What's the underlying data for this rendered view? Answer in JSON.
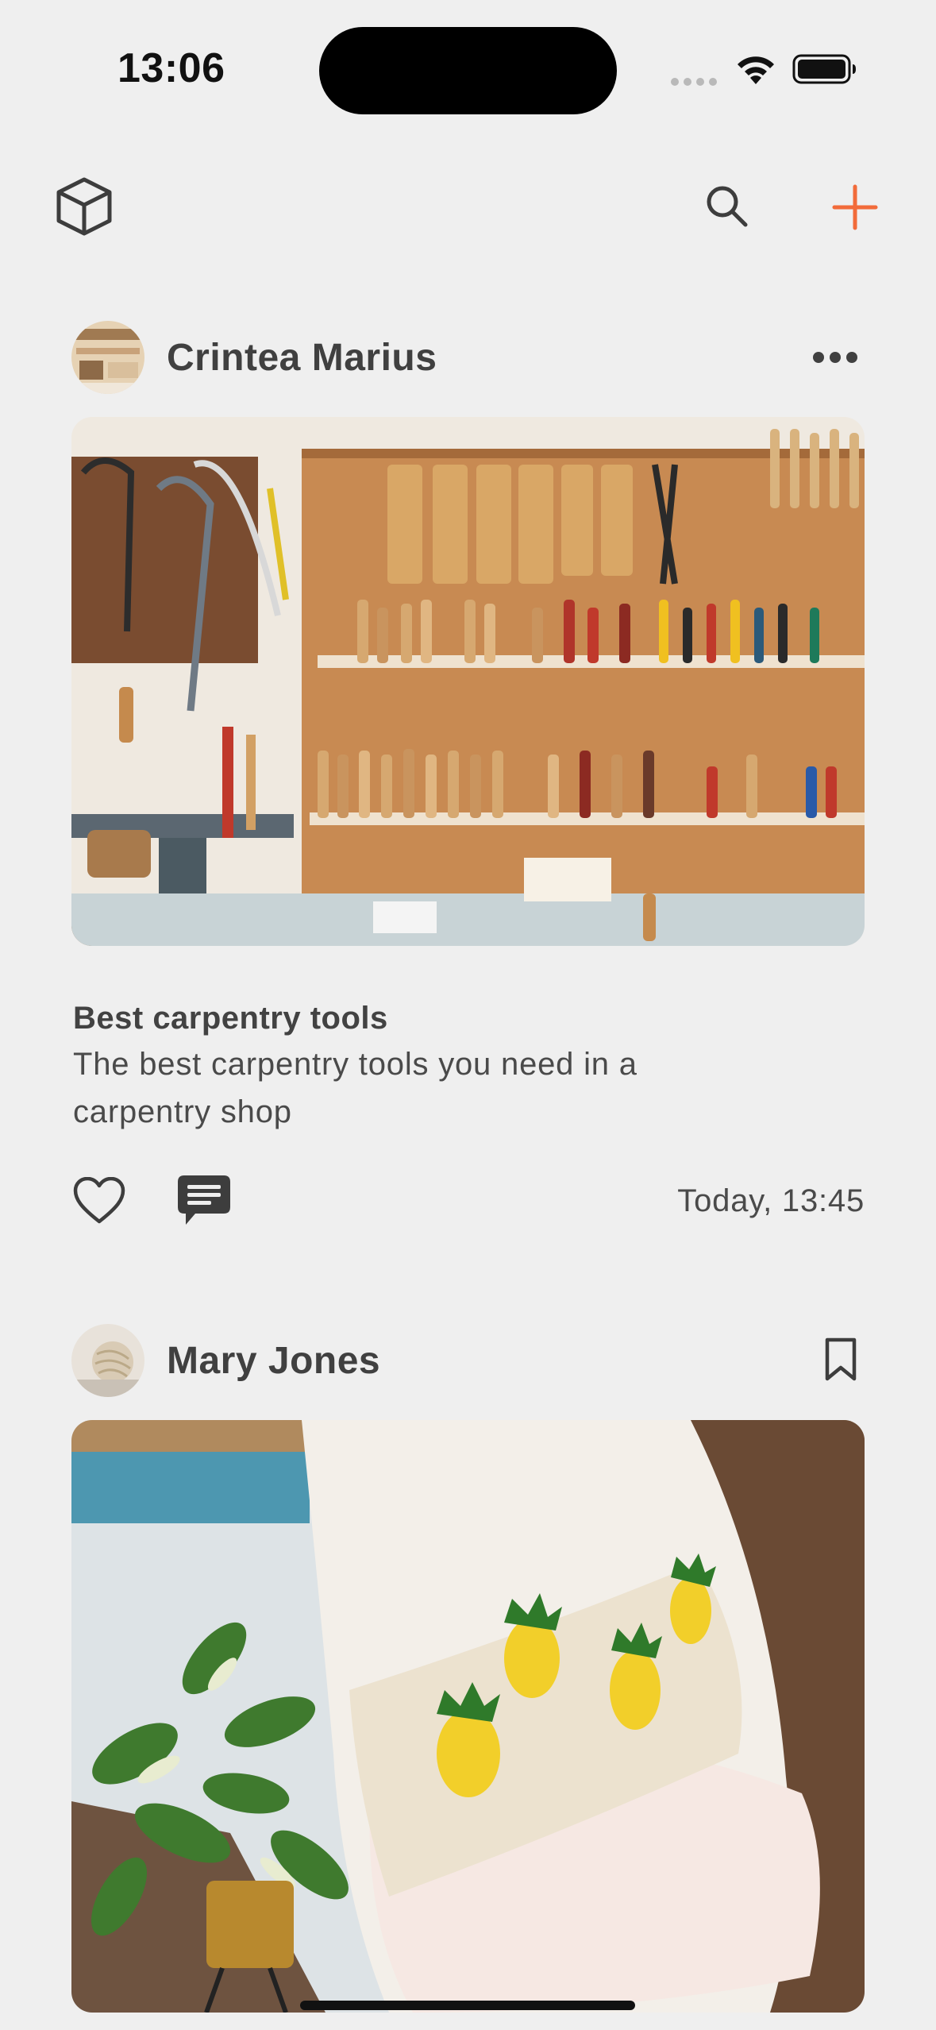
{
  "status_bar": {
    "time": "13:06"
  },
  "header": {
    "left_icon": "cube-icon",
    "search_icon": "search-icon",
    "add_icon": "plus-icon",
    "accent_color": "#f26b3a"
  },
  "posts": [
    {
      "author": "Crintea Marius",
      "menu_icon": "more-dots-icon",
      "image": "carpentry tools on a workshop wall",
      "title": "Best carpentry tools",
      "description": "The best carpentry tools you need in a carpentry shop",
      "timestamp": "Today, 13:45",
      "like_icon": "heart-icon",
      "comment_icon": "comment-icon"
    },
    {
      "author": "Mary Jones",
      "menu_icon": "bookmark-icon",
      "image": "crochet pineapple pillow on a white chair with a plant"
    }
  ]
}
